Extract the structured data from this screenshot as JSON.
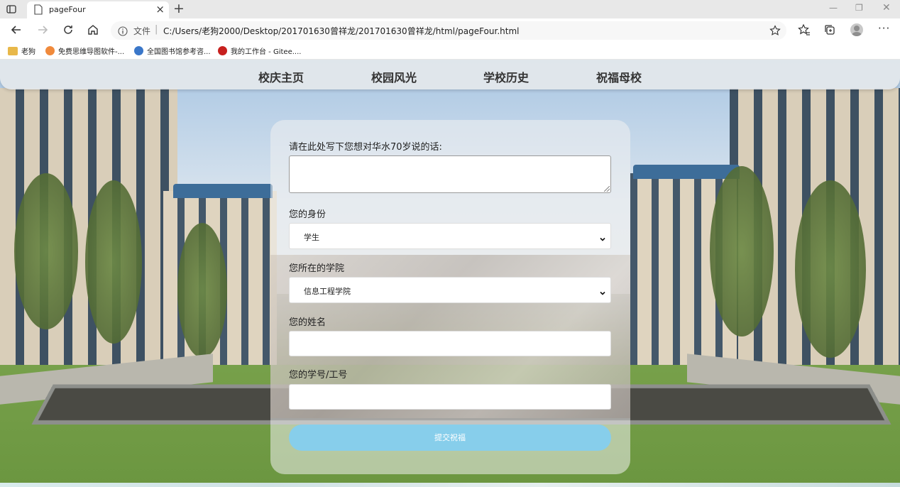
{
  "browser": {
    "tab_title": "pageFour",
    "url_label": "文件",
    "url": "C:/Users/老狗2000/Desktop/201701630曾祥龙/201701630曾祥龙/html/pageFour.html",
    "bookmarks": [
      {
        "label": "老狗"
      },
      {
        "label": "免费思维导图软件-..."
      },
      {
        "label": "全国图书馆参考咨..."
      },
      {
        "label": "我的工作台 - Gitee...."
      }
    ]
  },
  "site_nav": {
    "items": [
      {
        "label": "校庆主页"
      },
      {
        "label": "校园风光"
      },
      {
        "label": "学校历史"
      },
      {
        "label": "祝福母校"
      }
    ]
  },
  "form": {
    "message_label": "请在此处写下您想对华水70岁说的话:",
    "message_value": "",
    "identity_label": "您的身份",
    "identity_value": "学生",
    "college_label": "您所在的学院",
    "college_value": "信息工程学院",
    "name_label": "您的姓名",
    "name_value": "",
    "id_label": "您的学号/工号",
    "id_value": "",
    "submit_label": "提交祝福"
  },
  "colors": {
    "submit_bg": "#87ceeb",
    "nav_bg": "#e4e8ec"
  }
}
